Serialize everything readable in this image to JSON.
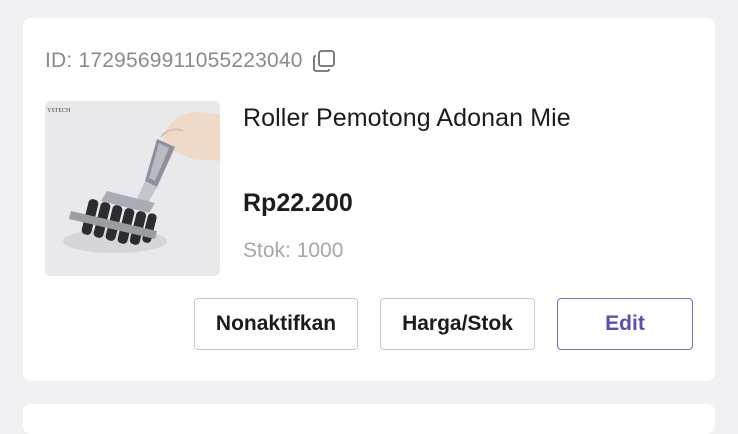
{
  "product": {
    "id_label": "ID: 1729569911055223040",
    "name": "Roller Pemotong Adonan Mie",
    "price": "Rp22.200",
    "stock_label": "Stok:",
    "stock_value": "1000",
    "image_brand_text": "YSTECH",
    "image_icon": "dough-roller-cutter-image"
  },
  "actions": {
    "deactivate_label": "Nonaktifkan",
    "price_stock_label": "Harga/Stok",
    "edit_label": "Edit"
  },
  "icons": {
    "copy": "copy-icon"
  },
  "colors": {
    "background": "#f1f1f3",
    "card": "#ffffff",
    "edit_accent": "#5b4fb3",
    "muted_text": "#8a8a8f"
  }
}
